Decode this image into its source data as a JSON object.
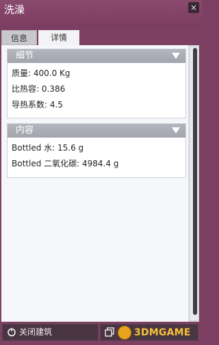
{
  "window": {
    "title": "洗澡",
    "close_glyph": "×"
  },
  "tabs": [
    {
      "label": "信息",
      "active": false
    },
    {
      "label": "详情",
      "active": true
    }
  ],
  "sections": {
    "details": {
      "title": "细节",
      "rows": [
        "质量: 400.0 Kg",
        "比热容: 0.386",
        "导热系数: 4.5"
      ]
    },
    "contents": {
      "title": "内容",
      "rows": [
        "Bottled 水: 15.6 g",
        "Bottled 二氧化碳: 4984.4 g"
      ]
    }
  },
  "footer": {
    "deconstruct_label": "关闭建筑",
    "watermark": "3DMGAME",
    "icons": {
      "deconstruct": "power-off-icon",
      "copy": "copy-building-icon"
    }
  },
  "colors": {
    "titlebar": "#7d3f62",
    "section_header": "#a9acb5",
    "content_bg": "#f6f7fb",
    "scrollbar": "#3c3c44"
  }
}
